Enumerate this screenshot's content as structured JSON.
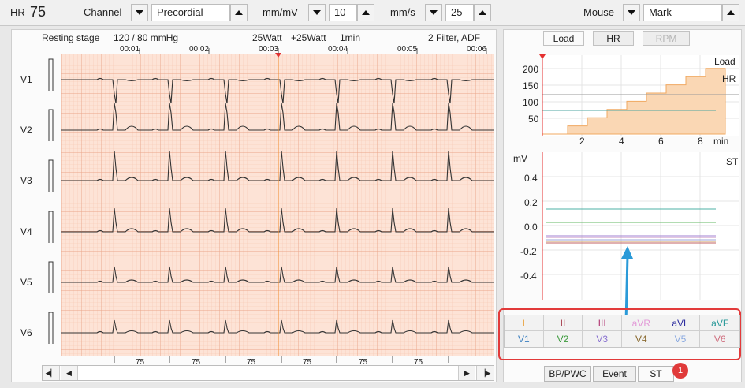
{
  "toolbar": {
    "hr_label": "HR",
    "hr_value": "75",
    "channel_label": "Channel",
    "channel_value": "Precordial",
    "amplitude_label": "mm/mV",
    "amplitude_value": "10",
    "speed_label": "mm/s",
    "speed_value": "25",
    "mouse_label": "Mouse",
    "mouse_value": "Mark"
  },
  "ecg": {
    "stage": "Resting stage",
    "bp": "120 / 80 mmHg",
    "watt": "25Watt",
    "watt_increment": "+25Watt",
    "interval": "1min",
    "filter": "2 Filter, ADF",
    "time_marks": [
      "00:01",
      "00:02",
      "00:03",
      "00:04",
      "00:05",
      "00:06"
    ],
    "leads": [
      "V1",
      "V2",
      "V3",
      "V4",
      "V5",
      "V6"
    ],
    "hr_marks": [
      "75",
      "75",
      "75",
      "75",
      "75",
      "75"
    ],
    "colors": {
      "grid_bg": "#fde3d6",
      "grid_minor": "#f6c6b0",
      "grid_major": "#eaa58a",
      "trace": "#333333",
      "cursor": "#f08a2a"
    }
  },
  "tabs": [
    "Load",
    "HR",
    "RPM"
  ],
  "load_chart": {
    "series_label_load": "Load",
    "series_label_hr": "HR",
    "y_ticks": [
      "200",
      "150",
      "100",
      "50"
    ],
    "x_ticks": [
      "2",
      "4",
      "6",
      "8"
    ],
    "x_unit": "min",
    "step_fill_color": "#fad7b4",
    "step_line_color": "#f0a860",
    "hr_line_color": "#4da6a0"
  },
  "st_chart": {
    "y_unit": "mV",
    "label": "ST",
    "y_ticks": [
      "0.4",
      "0.2",
      "0.0",
      "-0.2",
      "-0.4"
    ],
    "line_colors": [
      "#4db0a6",
      "#66b866",
      "#a07fd0",
      "#c88fc0",
      "#9ea6d8",
      "#d0a060",
      "#c06060"
    ]
  },
  "lead_grid": {
    "row1": [
      {
        "label": "I",
        "color": "#e8a03c"
      },
      {
        "label": "II",
        "color": "#a03040"
      },
      {
        "label": "III",
        "color": "#b03070"
      },
      {
        "label": "aVR",
        "color": "#e39ad8"
      },
      {
        "label": "aVL",
        "color": "#3030a0"
      },
      {
        "label": "aVF",
        "color": "#2a9a9a"
      }
    ],
    "row2": [
      {
        "label": "V1",
        "color": "#3a7fc0"
      },
      {
        "label": "V2",
        "color": "#3c9a3c"
      },
      {
        "label": "V3",
        "color": "#8870d0"
      },
      {
        "label": "V4",
        "color": "#8a6a30"
      },
      {
        "label": "V5",
        "color": "#88a8e0"
      },
      {
        "label": "V6",
        "color": "#d07080"
      }
    ]
  },
  "bottom_buttons": [
    "BP/PWC",
    "Event",
    "ST"
  ],
  "badge": "1"
}
